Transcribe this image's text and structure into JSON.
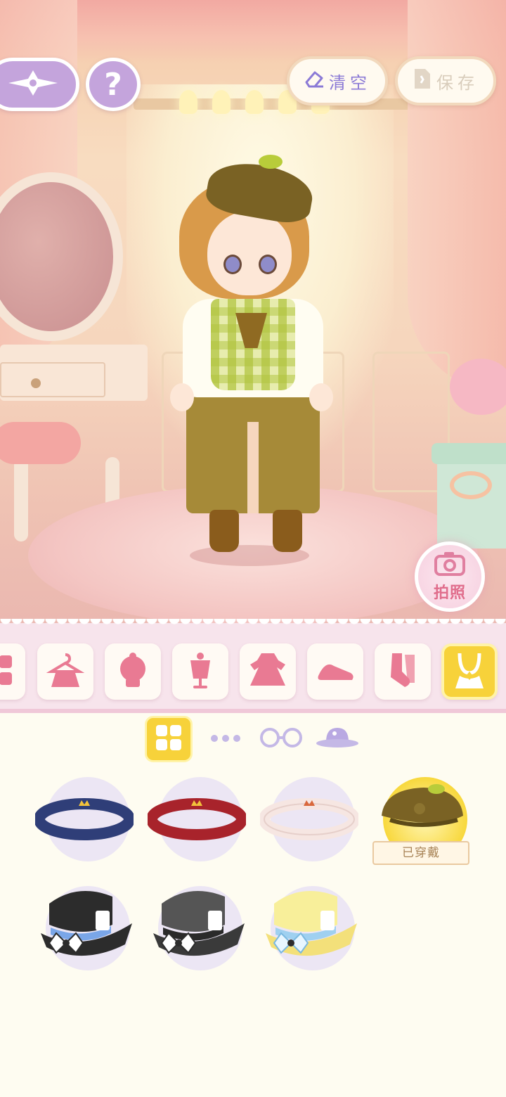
{
  "toolbar": {
    "back_icon": "compass-arrow-icon",
    "help_label": "?",
    "clear_label": "清空",
    "save_label": "保存"
  },
  "camera": {
    "label": "拍照",
    "icon": "camera-icon"
  },
  "categories": [
    {
      "name": "grid-more",
      "icon": "grid-icon"
    },
    {
      "name": "full-outfit",
      "icon": "dress-hanger-icon"
    },
    {
      "name": "hair",
      "icon": "hair-icon"
    },
    {
      "name": "top",
      "icon": "mannequin-icon"
    },
    {
      "name": "dress",
      "icon": "dress-icon"
    },
    {
      "name": "shoes",
      "icon": "shoe-icon"
    },
    {
      "name": "socks",
      "icon": "socks-icon"
    },
    {
      "name": "accessories",
      "icon": "necklace-icon",
      "active": true
    }
  ],
  "subtabs": [
    {
      "name": "all",
      "icon": "grid-icon",
      "active": true
    },
    {
      "name": "misc",
      "icon": "dots-icon"
    },
    {
      "name": "glasses",
      "icon": "glasses-icon"
    },
    {
      "name": "hat",
      "icon": "hat-icon"
    }
  ],
  "items": [
    {
      "name": "navy-crown-headband",
      "color": "#2f3e78"
    },
    {
      "name": "red-crown-headband",
      "color": "#a8232b"
    },
    {
      "name": "white-crown-headband",
      "color": "#f6e6e2"
    },
    {
      "name": "olive-beret",
      "color": "#7a6224",
      "worn_label": "已穿戴"
    },
    {
      "name": "black-top-hat",
      "color": "#2c2c2c"
    },
    {
      "name": "gray-top-hat",
      "color": "#555555"
    },
    {
      "name": "yellow-top-hat",
      "color": "#f8ef9a"
    }
  ],
  "colors": {
    "accent_purple": "#c4a4dc",
    "accent_yellow": "#f7d23a",
    "category_pink": "#e97a93"
  }
}
